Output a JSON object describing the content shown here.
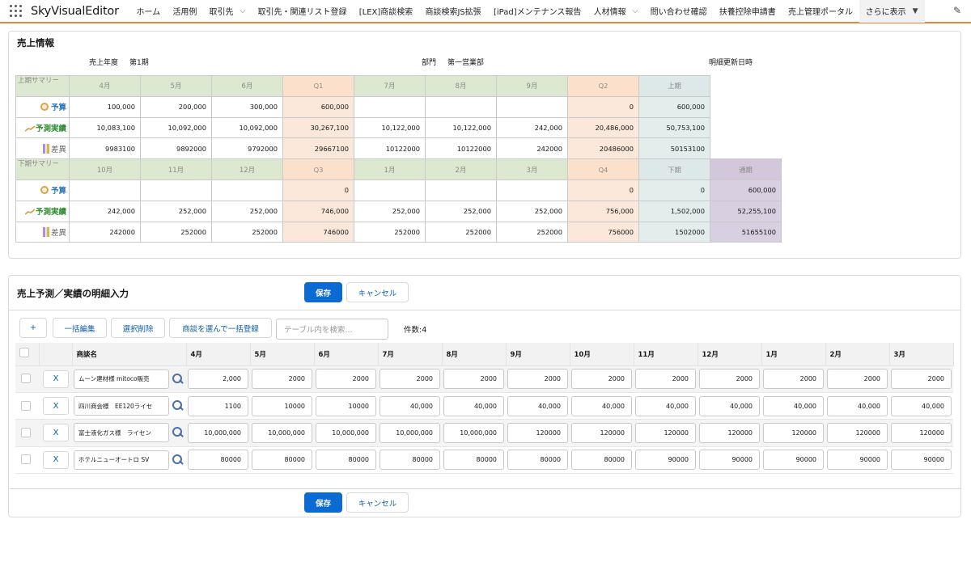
{
  "nav": {
    "app_name": "SkyVisualEditor",
    "items": [
      {
        "label": "ホーム",
        "dropdown": false
      },
      {
        "label": "活用例",
        "dropdown": false
      },
      {
        "label": "取引先",
        "dropdown": true
      },
      {
        "label": "取引先・関連リスト登録",
        "dropdown": false
      },
      {
        "label": "[LEX]商談検索",
        "dropdown": false
      },
      {
        "label": "商談検索JS拡張",
        "dropdown": false
      },
      {
        "label": "[iPad]メンテナンス報告",
        "dropdown": false
      },
      {
        "label": "人材情報",
        "dropdown": true
      },
      {
        "label": "問い合わせ確認",
        "dropdown": false
      },
      {
        "label": "扶養控除申請書",
        "dropdown": false
      },
      {
        "label": "売上管理ポータル",
        "dropdown": false
      }
    ],
    "more_label": "さらに表示"
  },
  "sales_info": {
    "title": "売上情報",
    "fiscal_year_label": "売上年度",
    "fiscal_year_value": "第1期",
    "department_label": "部門",
    "department_value": "第一営業部",
    "detail_updated_label": "明細更新日時"
  },
  "first_half": {
    "header_label": "上期サマリー",
    "columns": [
      "4月",
      "5月",
      "6月",
      "Q1",
      "7月",
      "8月",
      "9月",
      "Q2",
      "上期"
    ],
    "rows": [
      {
        "label": "予算",
        "values": [
          "100,000",
          "200,000",
          "300,000",
          "600,000",
          "",
          "",
          "",
          "0",
          "600,000"
        ]
      },
      {
        "label": "予測実績",
        "values": [
          "10,083,100",
          "10,092,000",
          "10,092,000",
          "30,267,100",
          "10,122,000",
          "10,122,000",
          "242,000",
          "20,486,000",
          "50,753,100"
        ]
      },
      {
        "label": "差異",
        "values": [
          "9983100",
          "9892000",
          "9792000",
          "29667100",
          "10122000",
          "10122000",
          "242000",
          "20486000",
          "50153100"
        ]
      }
    ]
  },
  "second_half": {
    "header_label": "下期サマリー",
    "columns": [
      "10月",
      "11月",
      "12月",
      "Q3",
      "1月",
      "2月",
      "3月",
      "Q4",
      "下期",
      "通期"
    ],
    "rows": [
      {
        "label": "予算",
        "values": [
          "",
          "",
          "",
          "0",
          "",
          "",
          "",
          "0",
          "0",
          "600,000"
        ]
      },
      {
        "label": "予測実績",
        "values": [
          "242,000",
          "252,000",
          "252,000",
          "746,000",
          "252,000",
          "252,000",
          "252,000",
          "756,000",
          "1,502,000",
          "52,255,100"
        ]
      },
      {
        "label": "差異",
        "values": [
          "242000",
          "252000",
          "252000",
          "746000",
          "252000",
          "252000",
          "252000",
          "756000",
          "1502000",
          "51655100"
        ]
      }
    ]
  },
  "detail": {
    "title": "売上予測／実績の明細入力",
    "save_label": "保存",
    "cancel_label": "キャンセル",
    "toolbar": {
      "add_label": "+",
      "bulk_edit_label": "一括編集",
      "delete_selected_label": "選択削除",
      "bulk_register_label": "商談を選んで一括登録",
      "search_placeholder": "テーブル内を検索...",
      "count_label": "件数:4"
    },
    "columns": [
      "商談名",
      "4月",
      "5月",
      "6月",
      "7月",
      "8月",
      "9月",
      "10月",
      "11月",
      "12月",
      "1月",
      "2月",
      "3月"
    ],
    "delete_label": "X",
    "rows": [
      {
        "name": "ムーン建材様 mitoco販売",
        "values": [
          "2,000",
          "2000",
          "2000",
          "2000",
          "2000",
          "2000",
          "2000",
          "2000",
          "2000",
          "2000",
          "2000",
          "2000"
        ]
      },
      {
        "name": "四川商会様　EE120ライセ",
        "values": [
          "1100",
          "10000",
          "10000",
          "40,000",
          "40,000",
          "40,000",
          "40,000",
          "40,000",
          "40,000",
          "40,000",
          "40,000",
          "40,000"
        ]
      },
      {
        "name": "富士液化ガス様　ライセン",
        "values": [
          "10,000,000",
          "10,000,000",
          "10,000,000",
          "10,000,000",
          "10,000,000",
          "120000",
          "120000",
          "120000",
          "120000",
          "120000",
          "120000",
          "120000"
        ]
      },
      {
        "name": "ホテルニューオートロ SV",
        "values": [
          "80000",
          "80000",
          "80000",
          "80000",
          "80000",
          "80000",
          "80000",
          "90000",
          "90000",
          "90000",
          "90000",
          "90000"
        ]
      }
    ]
  }
}
